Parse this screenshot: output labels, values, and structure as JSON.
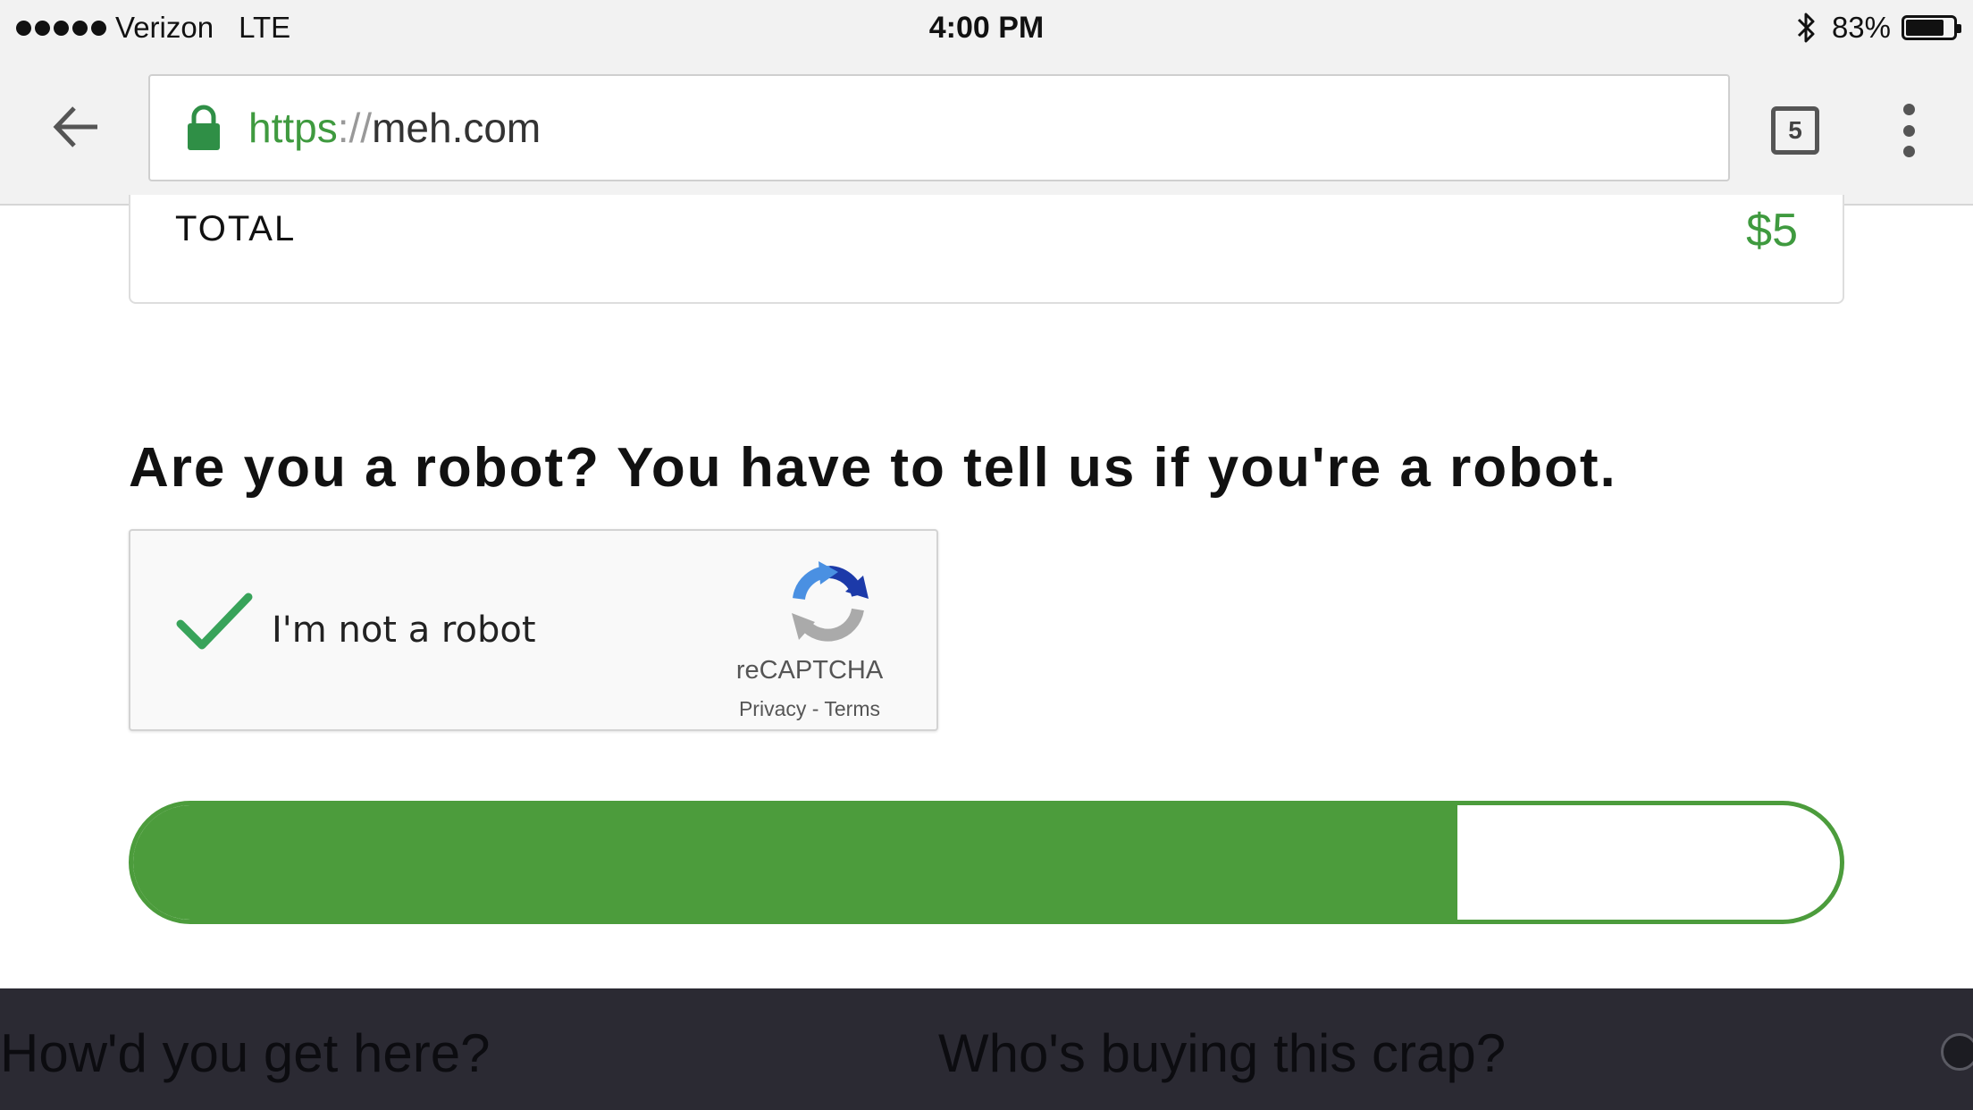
{
  "status_bar": {
    "carrier": "Verizon",
    "network": "LTE",
    "time": "4:00 PM",
    "battery_percent": "83%",
    "battery_level": 0.83,
    "icons": [
      "signal-dots-icon",
      "bluetooth-icon",
      "battery-icon"
    ]
  },
  "browser": {
    "url_scheme": "https",
    "url_separator": "://",
    "url_host": "meh.com",
    "tab_count": "5",
    "icons": [
      "back-arrow-icon",
      "lock-icon",
      "tabs-icon",
      "kebab-menu-icon"
    ]
  },
  "order": {
    "total_label": "TOTAL",
    "total_value": "$5"
  },
  "robot_check": {
    "heading": "Are you a robot? You have to tell us if you're a robot.",
    "checkbox_label": "I'm not a robot",
    "brand": "reCAPTCHA",
    "links": "Privacy - Terms",
    "checked": true
  },
  "progress": {
    "fill_fraction": 0.776
  },
  "footer": {
    "link_1": "How'd you get here?",
    "link_2": "Who's buying this crap?"
  },
  "colors": {
    "accent_green": "#4c9c3c",
    "url_green": "#3f9a3f",
    "footer_bg": "#2b2a33",
    "toolbar_bg": "#f2f2f2"
  }
}
